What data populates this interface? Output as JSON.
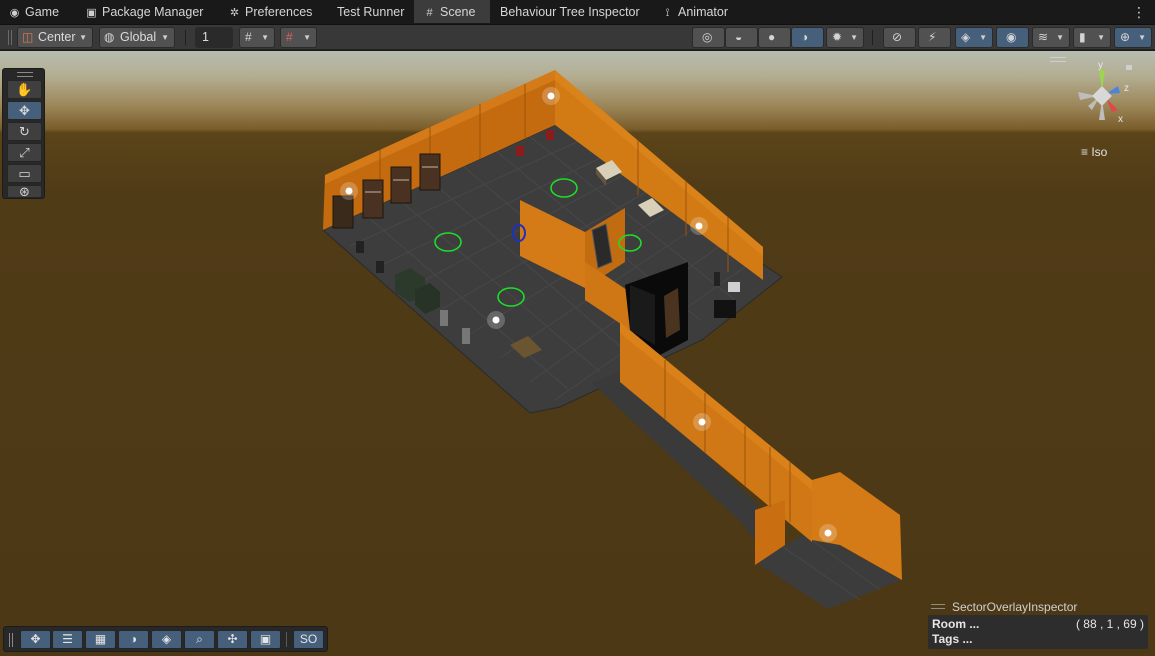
{
  "tabs": [
    {
      "label": "Game",
      "icon": "gamepad-icon",
      "glyph": "◉"
    },
    {
      "label": "Package Manager",
      "icon": "package-icon",
      "glyph": "▣"
    },
    {
      "label": "Preferences",
      "icon": "gear-icon",
      "glyph": "✲"
    },
    {
      "label": "Test Runner",
      "icon": "",
      "glyph": ""
    },
    {
      "label": "Scene",
      "icon": "grid-hash-icon",
      "glyph": "#",
      "active": true
    },
    {
      "label": "Behaviour Tree Inspector",
      "icon": "",
      "glyph": ""
    },
    {
      "label": "Animator",
      "icon": "animator-icon",
      "glyph": "⟟"
    }
  ],
  "toolbar": {
    "pivot_mode": "Center",
    "pivot_rotation": "Global",
    "grid_snap_value": "1",
    "draw_modes": [
      "wireframe",
      "shaded-wireframe",
      "unlit",
      "lit"
    ],
    "active_draw_mode": "lit"
  },
  "tools": [
    "View",
    "Move",
    "Rotate",
    "Scale",
    "Rect",
    "Transform"
  ],
  "active_tool": "Move",
  "scene": {
    "projection_label": "Iso",
    "axes": {
      "y": "y",
      "z": "z",
      "x": "x"
    }
  },
  "sector_overlay": {
    "title": "SectorOverlayInspector",
    "room_label": "Room ...",
    "room_coords": "( 88 , 1 , 69 )",
    "tags_label": "Tags ..."
  },
  "bottom_toolbar": {
    "so_label": "SO"
  },
  "colors": {
    "wall": "#d27a14",
    "floor": "#3a3a3a",
    "ground": "#4c3815",
    "accent": "#46607c",
    "waypoint": "#1fdc2a"
  }
}
